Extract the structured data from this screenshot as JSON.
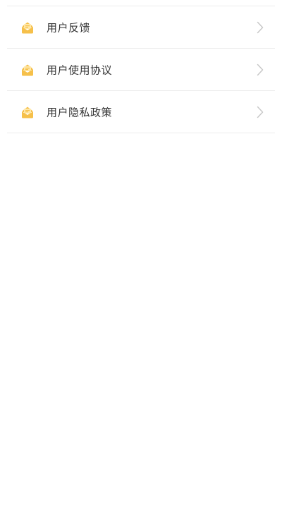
{
  "colors": {
    "icon_primary": "#F6C04A",
    "icon_light": "#FFE7A6",
    "divider": "#ECECEC",
    "text": "#333333",
    "chevron": "#C8C8C8",
    "background": "#FFFFFF"
  },
  "menu": {
    "items": [
      {
        "label": "用户反馈",
        "icon": "envelope-icon",
        "trailing_icon": "chevron-right-icon"
      },
      {
        "label": "用户使用协议",
        "icon": "envelope-icon",
        "trailing_icon": "chevron-right-icon"
      },
      {
        "label": "用户隐私政策",
        "icon": "envelope-icon",
        "trailing_icon": "chevron-right-icon"
      }
    ]
  }
}
